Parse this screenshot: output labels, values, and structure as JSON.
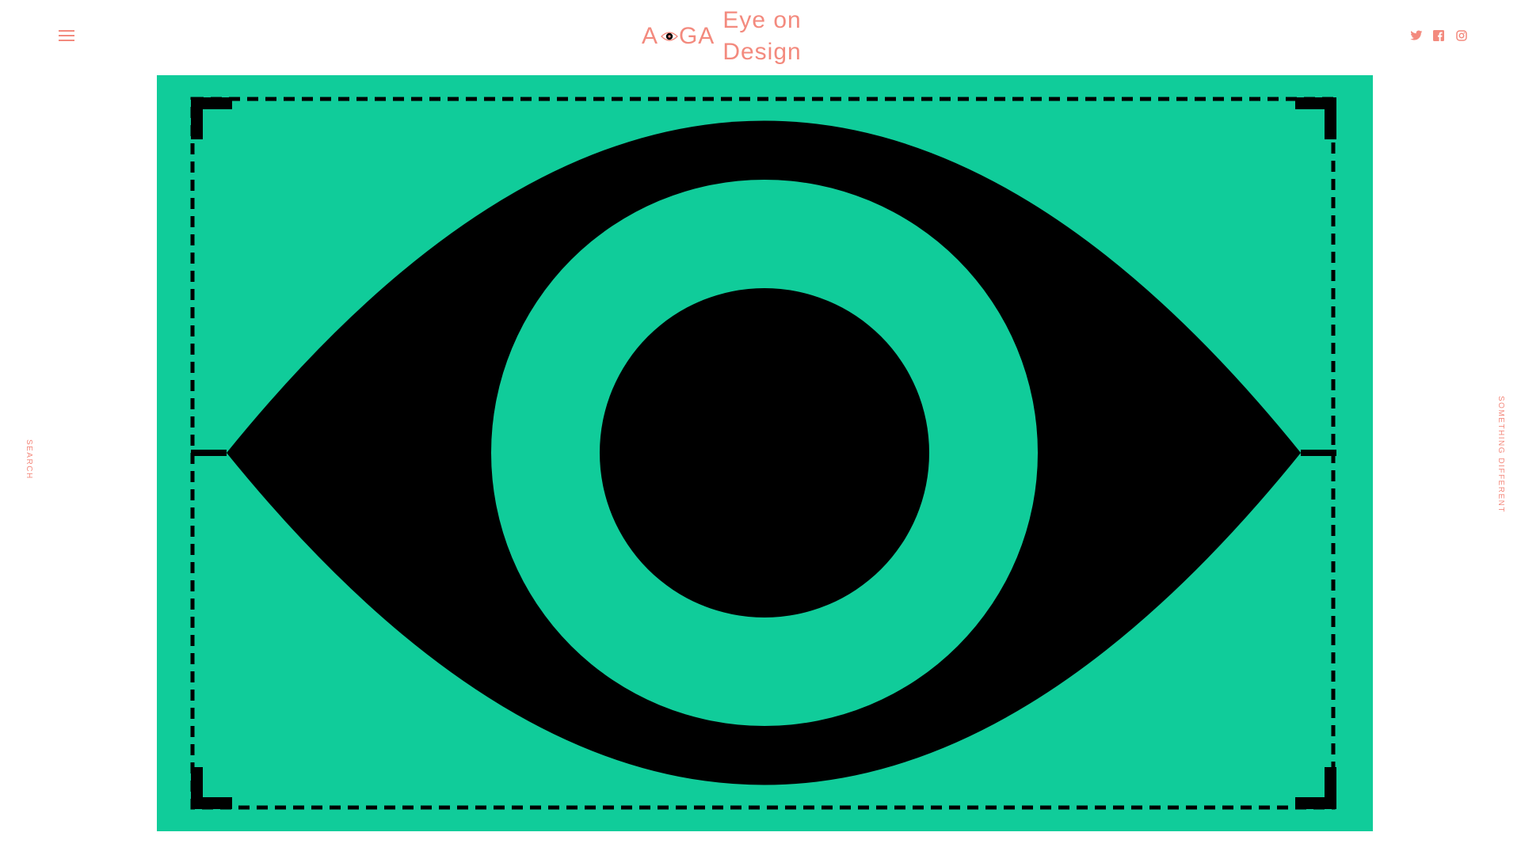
{
  "header": {
    "menu_icon": "hamburger-menu-icon",
    "logo": {
      "part_a": "A",
      "eye_icon": "eye-logo-icon",
      "part_ga": "GA",
      "part_rest": "Eye on Design"
    },
    "social": [
      {
        "name": "twitter",
        "icon": "twitter-icon"
      },
      {
        "name": "facebook",
        "icon": "facebook-icon"
      },
      {
        "name": "instagram",
        "icon": "instagram-icon"
      }
    ]
  },
  "side": {
    "left_label": "SEARCH",
    "right_label": "SOMETHING DIFFERENT"
  },
  "hero": {
    "illustration": "eye-illustration",
    "background_color": "#10cc9a",
    "foreground_color": "#000000"
  },
  "colors": {
    "accent": "#f38a7e",
    "background": "#ffffff"
  }
}
